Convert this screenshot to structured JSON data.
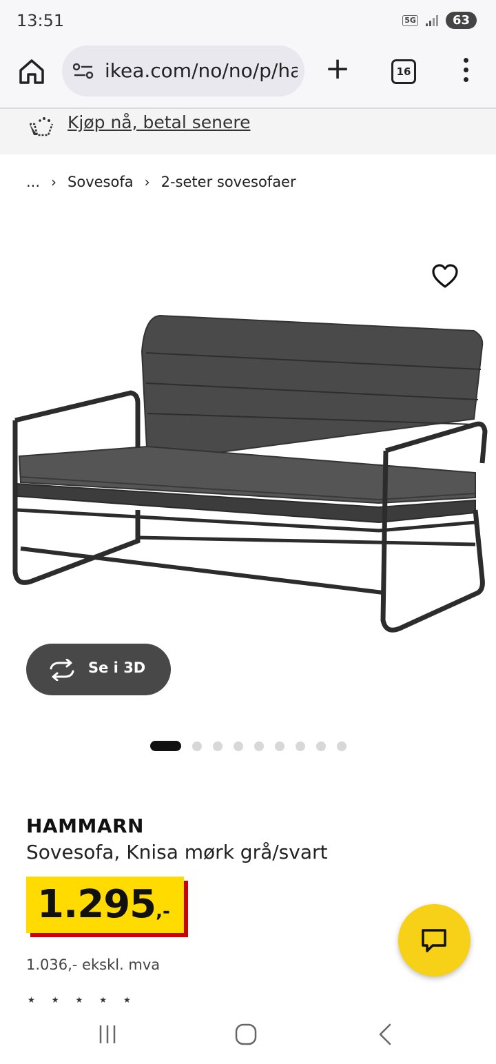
{
  "status_bar": {
    "time": "13:51",
    "network": "5G",
    "battery": "63"
  },
  "browser": {
    "url": "ikea.com/no/no/p/ha",
    "tab_count": "16"
  },
  "promo": {
    "text": "Kjøp nå, betal senere"
  },
  "breadcrumb": {
    "ellipsis": "...",
    "items": [
      "Sovesofa",
      "2-seter sovesofaer"
    ]
  },
  "gallery": {
    "view_3d_label": "Se i 3D",
    "image_count": 9,
    "active_index": 0
  },
  "product": {
    "brand": "HAMMARN",
    "description": "Sovesofa, Knisa mørk grå/svart",
    "price_integer": "1.295",
    "price_suffix": ",-",
    "price_ex_vat": "1.036,- ekskl. mva"
  },
  "colors": {
    "price_bg": "#ffdb00",
    "price_shadow": "#cc0008",
    "chat_button": "#f7d117",
    "button_dark": "#484848"
  }
}
